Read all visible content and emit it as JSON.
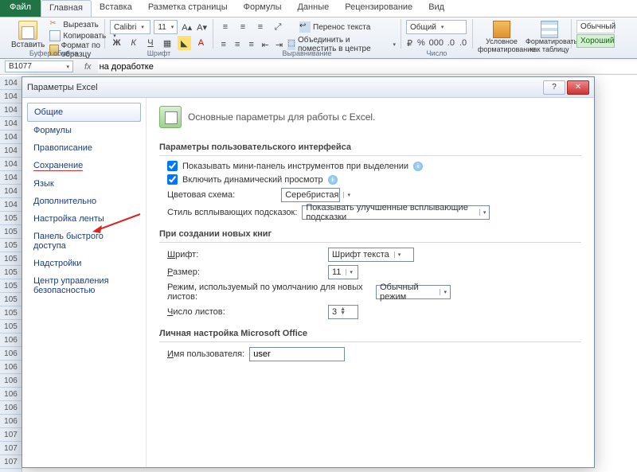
{
  "ribbon": {
    "file_tab": "Файл",
    "tabs": [
      "Главная",
      "Вставка",
      "Разметка страницы",
      "Формулы",
      "Данные",
      "Рецензирование",
      "Вид"
    ],
    "active_tab": 0,
    "clipboard": {
      "paste": "Вставить",
      "cut": "Вырезать",
      "copy": "Копировать",
      "format_painter": "Формат по образцу",
      "group_label": "Буфер обмена"
    },
    "font": {
      "name": "Calibri",
      "size": "11",
      "group_label": "Шрифт"
    },
    "alignment": {
      "wrap": "Перенос текста",
      "merge": "Объединить и поместить в центре",
      "group_label": "Выравнивание"
    },
    "number": {
      "format": "Общий",
      "group_label": "Число"
    },
    "styles": {
      "cond": "Условное форматирование",
      "table": "Форматировать как таблицу",
      "normal": "Обычный",
      "good": "Хороший"
    }
  },
  "name_box": "B1077",
  "fx": "fx",
  "formula_value": "на доработке",
  "row_headers": [
    "104",
    "104",
    "104",
    "104",
    "104",
    "104",
    "104",
    "104",
    "104",
    "104",
    "105",
    "105",
    "105",
    "105",
    "105",
    "105",
    "105",
    "105",
    "105",
    "106",
    "106",
    "106",
    "106",
    "106",
    "106",
    "106",
    "107",
    "107",
    "107"
  ],
  "dialog": {
    "title": "Параметры Excel",
    "sidebar": [
      "Общие",
      "Формулы",
      "Правописание",
      "Сохранение",
      "Язык",
      "Дополнительно",
      "Настройка ленты",
      "Панель быстрого доступа",
      "Надстройки",
      "Центр управления безопасностью"
    ],
    "selected_sidebar": 0,
    "annotated_sidebar": 3,
    "heading": "Основные параметры для работы с Excel.",
    "sections": {
      "ui": {
        "title": "Параметры пользовательского интерфейса",
        "show_mini": "Показывать мини-панель инструментов при выделении",
        "live_preview": "Включить динамический просмотр",
        "color_scheme_label": "Цветовая схема:",
        "color_scheme_value": "Серебристая",
        "tooltip_style_label": "Стиль всплывающих подсказок:",
        "tooltip_style_value": "Показывать улучшенные всплывающие подсказки"
      },
      "new_wb": {
        "title": "При создании новых книг",
        "font_label": "Шрифт:",
        "font_value": "Шрифт текста",
        "size_label": "Размер:",
        "size_value": "11",
        "view_label": "Режим, используемый по умолчанию для новых листов:",
        "view_value": "Обычный режим",
        "sheets_label": "Число листов:",
        "sheets_value": "3"
      },
      "personal": {
        "title": "Личная настройка Microsoft Office",
        "username_label": "Имя пользователя:",
        "username_value": "user"
      }
    }
  }
}
